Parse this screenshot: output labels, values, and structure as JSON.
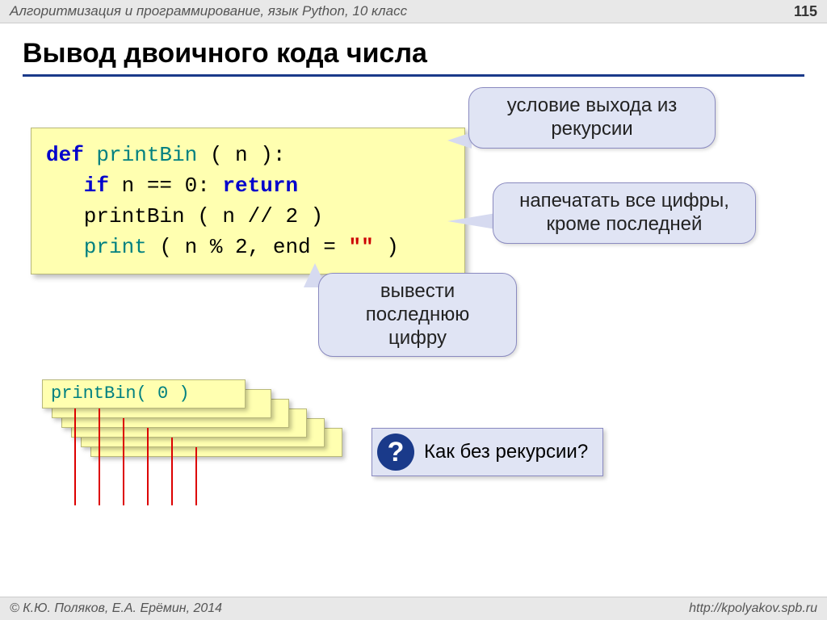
{
  "header": {
    "breadcrumb": "Алгоритмизация и программирование, язык Python, 10 класс",
    "page_number": "115"
  },
  "title": "Вывод двоичного кода числа",
  "code": {
    "l1_def": "def",
    "l1_name": " printBin",
    "l1_rest": " ( n ):",
    "l2_if": "   if",
    "l2_cond": " n == 0:",
    "l2_return": " return",
    "l3_call": "   printBin ( n // 2 )",
    "l4_print": "   print",
    "l4_args1": " ( n % 2, end = ",
    "l4_str": "\"\"",
    "l4_args2": " )"
  },
  "callouts": {
    "c1": "условие выхода из рекурсии",
    "c2": "напечатать все цифры, кроме последней",
    "c3": "вывести последнюю цифру"
  },
  "stack_call": "printBin( 0 )",
  "question": {
    "mark": "?",
    "text": "Как без рекурсии?"
  },
  "footer": {
    "left": "© К.Ю. Поляков, Е.А. Ерёмин, 2014",
    "right": "http://kpolyakov.spb.ru"
  }
}
